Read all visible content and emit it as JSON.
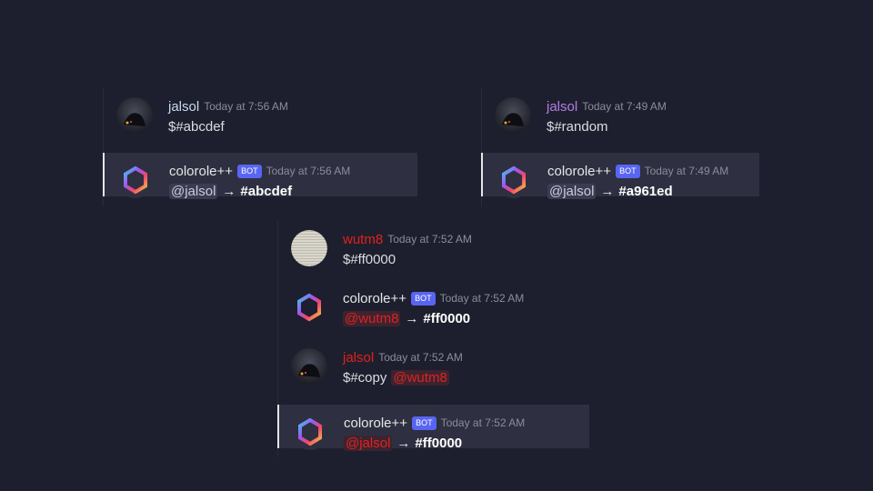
{
  "panels": [
    {
      "messages": [
        {
          "user": "jalsol",
          "time": "Today at 7:56 AM",
          "text": "$#abcdef"
        },
        {
          "user": "colorole++",
          "bot": "BOT",
          "time": "Today at 7:56 AM",
          "mention": "@jalsol",
          "arrow": "→",
          "hex": "#abcdef"
        }
      ]
    },
    {
      "messages": [
        {
          "user": "jalsol",
          "time": "Today at 7:49 AM",
          "text": "$#random"
        },
        {
          "user": "colorole++",
          "bot": "BOT",
          "time": "Today at 7:49 AM",
          "mention": "@jalsol",
          "arrow": "→",
          "hex": "#a961ed"
        }
      ]
    },
    {
      "messages": [
        {
          "user": "wutm8",
          "time": "Today at 7:52 AM",
          "text": "$#ff0000"
        },
        {
          "user": "colorole++",
          "bot": "BOT",
          "time": "Today at 7:52 AM",
          "mention": "@wutm8",
          "arrow": "→",
          "hex": "#ff0000"
        },
        {
          "user": "jalsol",
          "time": "Today at 7:52 AM",
          "text": "$#copy",
          "mention": "@wutm8"
        },
        {
          "user": "colorole++",
          "bot": "BOT",
          "time": "Today at 7:52 AM",
          "mention": "@jalsol",
          "arrow": "→",
          "hex": "#ff0000"
        }
      ]
    }
  ],
  "colors": {
    "background": "#1e1f2e",
    "highlight": "#2e2f40",
    "bot_badge": "#5865f2",
    "red_role": "#e0221d",
    "purple_role": "#b27ee6"
  },
  "icons": {
    "user_avatar": "avatar-jalsol-icon",
    "bot_avatar": "colorole-hexagon-icon",
    "wutm8_avatar": "paper-texture-avatar-icon"
  }
}
